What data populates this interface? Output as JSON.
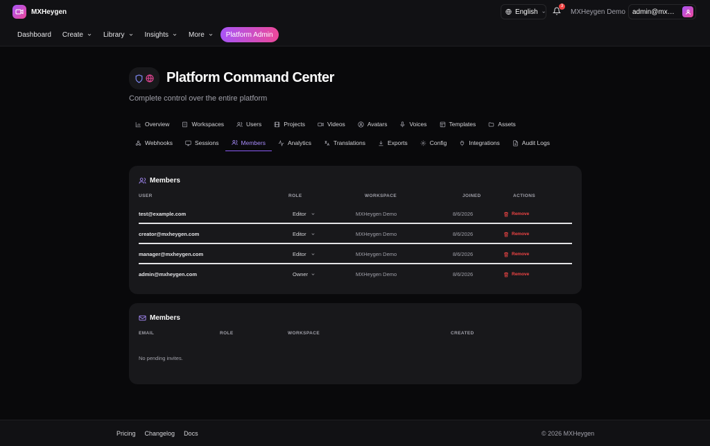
{
  "app": {
    "name": "MXHeygen"
  },
  "nav": {
    "items": [
      {
        "label": "Dashboard",
        "has_menu": false
      },
      {
        "label": "Create",
        "has_menu": true
      },
      {
        "label": "Library",
        "has_menu": true
      },
      {
        "label": "Insights",
        "has_menu": true
      },
      {
        "label": "More",
        "has_menu": true
      }
    ],
    "platform_admin": "Platform Admin"
  },
  "topbar": {
    "language": "English",
    "notifications_count": "3",
    "workspace": "MXHeygen Demo",
    "account": "admin@mxheygen.com"
  },
  "page": {
    "title": "Platform Command Center",
    "subtitle": "Complete control over the entire platform"
  },
  "tabs": {
    "row1": [
      {
        "label": "Overview",
        "icon": "chart-icon"
      },
      {
        "label": "Workspaces",
        "icon": "building-icon"
      },
      {
        "label": "Users",
        "icon": "users-icon"
      },
      {
        "label": "Projects",
        "icon": "projects-icon"
      },
      {
        "label": "Videos",
        "icon": "video-icon"
      },
      {
        "label": "Avatars",
        "icon": "avatar-icon"
      },
      {
        "label": "Voices",
        "icon": "mic-icon"
      },
      {
        "label": "Templates",
        "icon": "template-icon"
      },
      {
        "label": "Assets",
        "icon": "folder-icon"
      }
    ],
    "row2": [
      {
        "label": "Webhooks",
        "icon": "webhook-icon"
      },
      {
        "label": "Sessions",
        "icon": "monitor-icon"
      },
      {
        "label": "Members",
        "icon": "members-icon",
        "active": true
      },
      {
        "label": "Analytics",
        "icon": "activity-icon"
      },
      {
        "label": "Translations",
        "icon": "translate-icon"
      },
      {
        "label": "Exports",
        "icon": "download-icon"
      },
      {
        "label": "Config",
        "icon": "gear-icon"
      },
      {
        "label": "Integrations",
        "icon": "plug-icon"
      },
      {
        "label": "Audit Logs",
        "icon": "log-icon"
      }
    ]
  },
  "members_card": {
    "title": "Members",
    "columns": {
      "user": "USER",
      "role": "ROLE",
      "workspace": "WORKSPACE",
      "joined": "JOINED",
      "actions": "ACTIONS"
    },
    "rows": [
      {
        "email": "test@example.com",
        "role": "Editor",
        "workspace": "MXHeygen Demo",
        "joined": "8/6/2026",
        "action": "Remove"
      },
      {
        "email": "creator@mxheygen.com",
        "role": "Editor",
        "workspace": "MXHeygen Demo",
        "joined": "8/6/2026",
        "action": "Remove"
      },
      {
        "email": "manager@mxheygen.com",
        "role": "Editor",
        "workspace": "MXHeygen Demo",
        "joined": "8/6/2026",
        "action": "Remove"
      },
      {
        "email": "admin@mxheygen.com",
        "role": "Owner",
        "workspace": "MXHeygen Demo",
        "joined": "8/6/2026",
        "action": "Remove"
      }
    ]
  },
  "invites_card": {
    "title": "Members",
    "columns": {
      "email": "EMAIL",
      "role": "ROLE",
      "workspace": "WORKSPACE",
      "created": "CREATED"
    },
    "empty": "No pending invites."
  },
  "footer": {
    "links": [
      "Pricing",
      "Changelog",
      "Docs"
    ],
    "copyright": "© 2026 MXHeygen"
  },
  "colors": {
    "accent": "#8b5cf6",
    "gradient_start": "#a855f7",
    "gradient_end": "#ec4899",
    "danger": "#ef4444",
    "background": "#09090b",
    "card": "#18181b"
  }
}
